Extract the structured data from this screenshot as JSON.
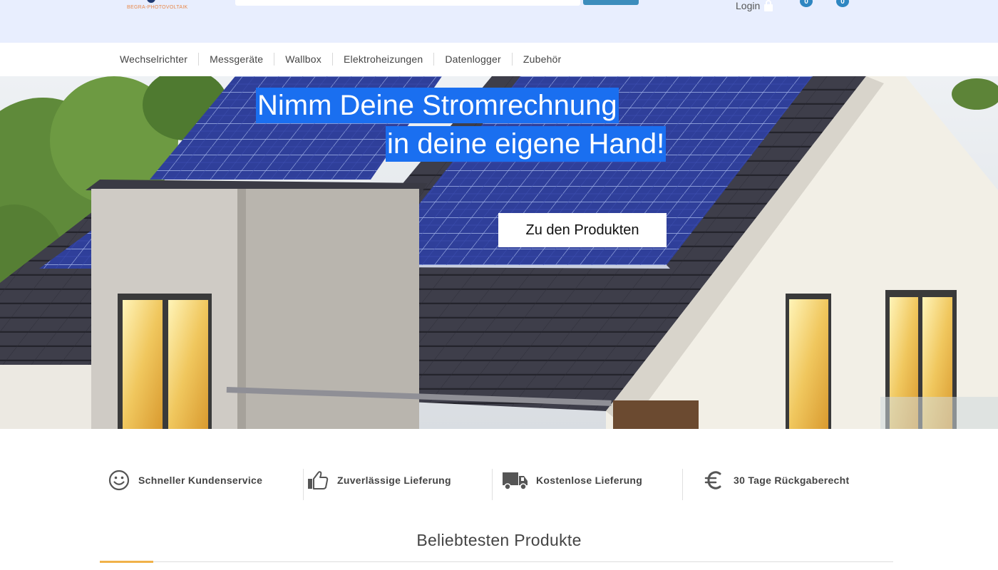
{
  "header": {
    "logo_text": "BEGRA-PHOTOVOLTAIK",
    "login_label": "Login",
    "cart_badge_1": "0",
    "cart_badge_2": "0"
  },
  "nav": {
    "items": [
      {
        "label": "Wechselrichter"
      },
      {
        "label": "Messgeräte"
      },
      {
        "label": "Wallbox"
      },
      {
        "label": "Elektroheizungen"
      },
      {
        "label": "Datenlogger"
      },
      {
        "label": "Zubehör"
      }
    ]
  },
  "hero": {
    "headline_line_1": "Nimm Deine Stromrechnung",
    "headline_line_2": "in deine eigene Hand!",
    "cta_label": "Zu den Produkten"
  },
  "features": [
    {
      "icon": "smiley-icon",
      "label": "Schneller Kundenservice"
    },
    {
      "icon": "thumbs-up-icon",
      "label": "Zuverlässige Lieferung"
    },
    {
      "icon": "truck-icon",
      "label": "Kostenlose Lieferung"
    },
    {
      "icon": "euro-icon",
      "label": "30 Tage Rückgaberecht"
    }
  ],
  "section": {
    "title": "Beliebtesten Produkte"
  },
  "colors": {
    "header_bg": "#e8eefe",
    "headline_bg": "#1a6ff0",
    "accent": "#f0b24a",
    "badge": "#2e86c1"
  }
}
